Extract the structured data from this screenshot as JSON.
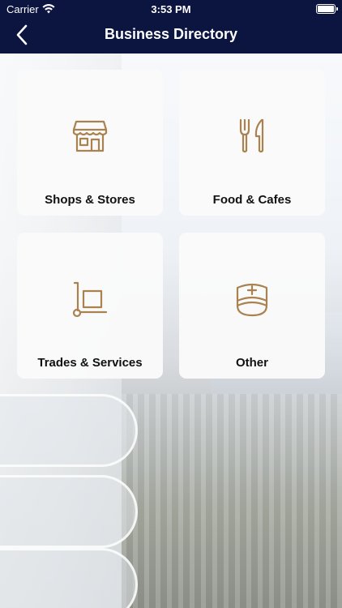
{
  "status_bar": {
    "carrier": "Carrier",
    "time": "3:53 PM"
  },
  "nav": {
    "title": "Business Directory",
    "back_icon": "chevron-left-icon"
  },
  "colors": {
    "nav_background": "#0b1540",
    "icon_gold": "#a98250",
    "tile_background": "#fafafa"
  },
  "categories": [
    {
      "label": "Shops & Stores",
      "icon": "storefront-icon"
    },
    {
      "label": "Food & Cafes",
      "icon": "fork-knife-icon"
    },
    {
      "label": "Trades & Services",
      "icon": "hand-truck-icon"
    },
    {
      "label": "Other",
      "icon": "nurse-cap-icon"
    }
  ]
}
